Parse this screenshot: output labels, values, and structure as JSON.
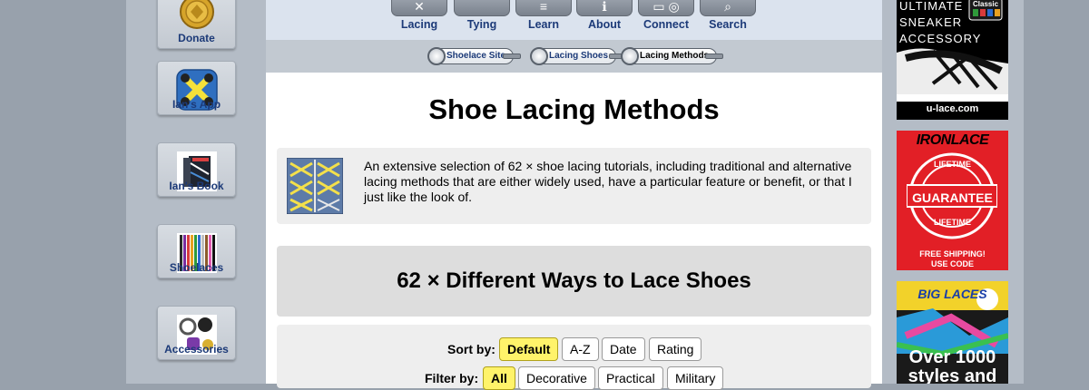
{
  "sidebar": {
    "items": [
      {
        "label": "Donate",
        "icon": "coin-icon"
      },
      {
        "label": "Ian's App",
        "icon": "app-icon"
      },
      {
        "label": "Ian's Book",
        "icon": "book-icon"
      },
      {
        "label": "Shoelaces",
        "icon": "shoelaces-icon"
      },
      {
        "label": "Accessories",
        "icon": "accessories-icon"
      }
    ]
  },
  "nav": {
    "tabs": [
      {
        "label": "Lacing"
      },
      {
        "label": "Tying"
      },
      {
        "label": "Learn"
      },
      {
        "label": "About"
      },
      {
        "label": "Connect"
      },
      {
        "label": "Search"
      }
    ]
  },
  "breadcrumb": {
    "items": [
      "Shoelace Site",
      "Lacing Shoes",
      "Lacing Methods"
    ]
  },
  "page": {
    "title": "Shoe Lacing Methods",
    "intro": "An extensive selection of 62 × shoe lacing tutorials, including traditional and alternative lacing methods that are either widely used, have a particular feature or benefit, or that I just like the look of.",
    "methods_heading": "62 × Different Ways to Lace Shoes"
  },
  "controls": {
    "sort_label": "Sort by:",
    "sort_options": [
      "Default",
      "A-Z",
      "Date",
      "Rating"
    ],
    "sort_selected": "Default",
    "filter_label": "Filter by:",
    "filter_options": [
      "All",
      "Decorative",
      "Practical",
      "Military"
    ],
    "filter_selected": "All"
  },
  "ads": {
    "ad1": {
      "line1": "ULTIMATE",
      "line2": "SNEAKER",
      "line3": "ACCESSORY",
      "badge": "Classic",
      "footer": "u-lace.com"
    },
    "ad2": {
      "brand": "IRONLACE",
      "ring_top": "LIFETIME",
      "center": "GUARANTEE",
      "ring_bottom": "LIFETIME",
      "line1": "FREE SHIPPING!",
      "line2": "USE CODE \"PROFSHOELACE\""
    },
    "ad3": {
      "brand": "BIG LACES",
      "line1": "Over 1000",
      "line2": "styles and"
    }
  },
  "colors": {
    "link_blue": "#1c3a78",
    "highlight_yellow": "#fff36a",
    "ironlace_red": "#e21f26"
  }
}
